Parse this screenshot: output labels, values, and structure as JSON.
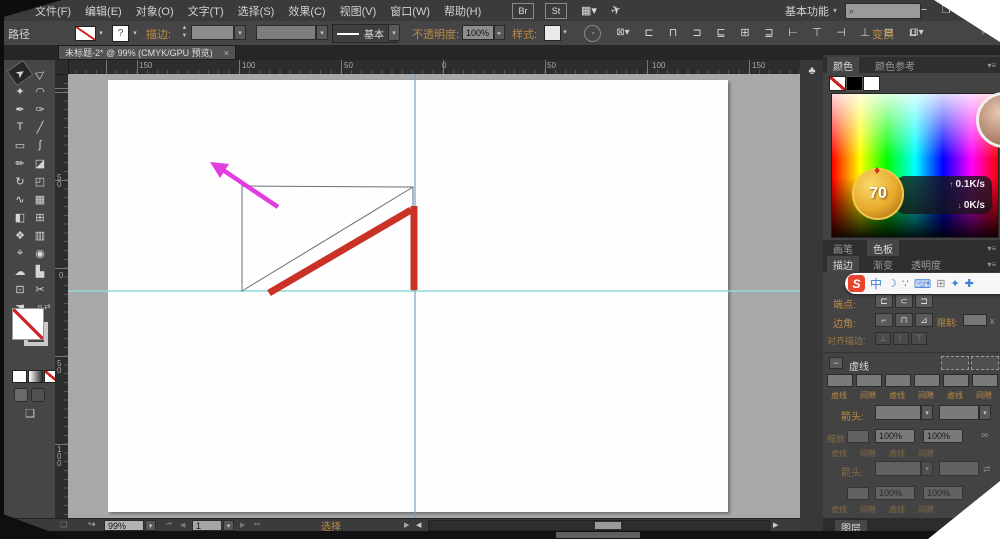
{
  "menu": {
    "items": [
      "文件(F)",
      "编辑(E)",
      "对象(O)",
      "文字(T)",
      "选择(S)",
      "效果(C)",
      "视图(V)",
      "窗口(W)",
      "帮助(H)"
    ],
    "br_label": "Br",
    "st_label": "St",
    "workspace": "基本功能"
  },
  "control": {
    "path_label": "路径",
    "stroke_unknown": "?",
    "stroke_label": "描边:",
    "line_style": "基本",
    "opacity_label": "不透明度:",
    "opacity_value": "100%",
    "style_label": "样式:",
    "transform_label": "变换"
  },
  "doc_tab": {
    "title": "未标题-2* @ 99% (CMYK/GPU 预览)",
    "close_label": "×"
  },
  "rulers": {
    "h": [
      "150",
      "100",
      "50",
      "0",
      "50",
      "100",
      "150"
    ],
    "v": [
      "50",
      "0",
      "50",
      "100"
    ]
  },
  "status": {
    "zoom_value": "99%",
    "artboard_value": "1",
    "mode_label": "选择"
  },
  "color_panel": {
    "tab_color": "颜色",
    "tab_guide": "颜色参考"
  },
  "swatch_tabs": {
    "brushes": "画笔",
    "swatches": "色板"
  },
  "stroke_tabs": {
    "stroke": "描边",
    "gradient": "渐变",
    "transparency": "透明度"
  },
  "stroke_panel": {
    "cap_label": "端点:",
    "corner_label": "边角:",
    "limit_label": "限制:",
    "limit_suffix": "x",
    "align_label": "对齐描边:",
    "dash_check_label": "虚线",
    "dash_cols": [
      "虚线",
      "间隙",
      "虚线",
      "间隙",
      "虚线",
      "间隙"
    ],
    "arrow_label": "箭头:",
    "scale_label": "缩放",
    "pct_1": "100%",
    "pct_2": "100%"
  },
  "layers": {
    "tab_label": "图层"
  },
  "overlay": {
    "speed_badge": "70",
    "up_speed": "0.1K/s",
    "down_speed": "0K/s"
  },
  "ime": {
    "logo": "S",
    "glyphs": [
      "中",
      "☽",
      "∵",
      "⌨",
      "⊞",
      "✦",
      "✚"
    ]
  },
  "glyphs": {
    "tools": [
      "➤",
      "▷",
      "✦",
      "◠",
      "✒",
      "✑",
      "T",
      "╱",
      "▭",
      "∫",
      "✏",
      "◪",
      "↻",
      "◰",
      "∿",
      "▦",
      "◧",
      "⊞",
      "❖",
      "▥",
      "⌖",
      "◉",
      "☁",
      "▙",
      "⊡",
      "✂",
      "☚",
      "⌕"
    ],
    "control_aligns": [
      "⊏",
      "⊓",
      "⊐",
      "⊑",
      "⊞",
      "⊒",
      "⊢",
      "⊤",
      "⊣",
      "⊥",
      "⊟",
      "⊔"
    ],
    "caps": [
      "⊏",
      "⊂",
      "⊐"
    ],
    "corners": [
      "⌐",
      "⊓",
      "⊿"
    ],
    "stroke_aligns": [
      "⊥",
      "⊦",
      "⊤"
    ],
    "collapse": "♣",
    "swap_arrows": "⇄",
    "link": "∞"
  },
  "colors": {
    "accent_amber": "#bd8a45",
    "shape_red": "#cb3227",
    "arrow_magenta": "#e13de1",
    "guide_cyan": "#8fd9d9",
    "guide_blue": "#7aa1c0",
    "ime_red": "#e8442e"
  }
}
